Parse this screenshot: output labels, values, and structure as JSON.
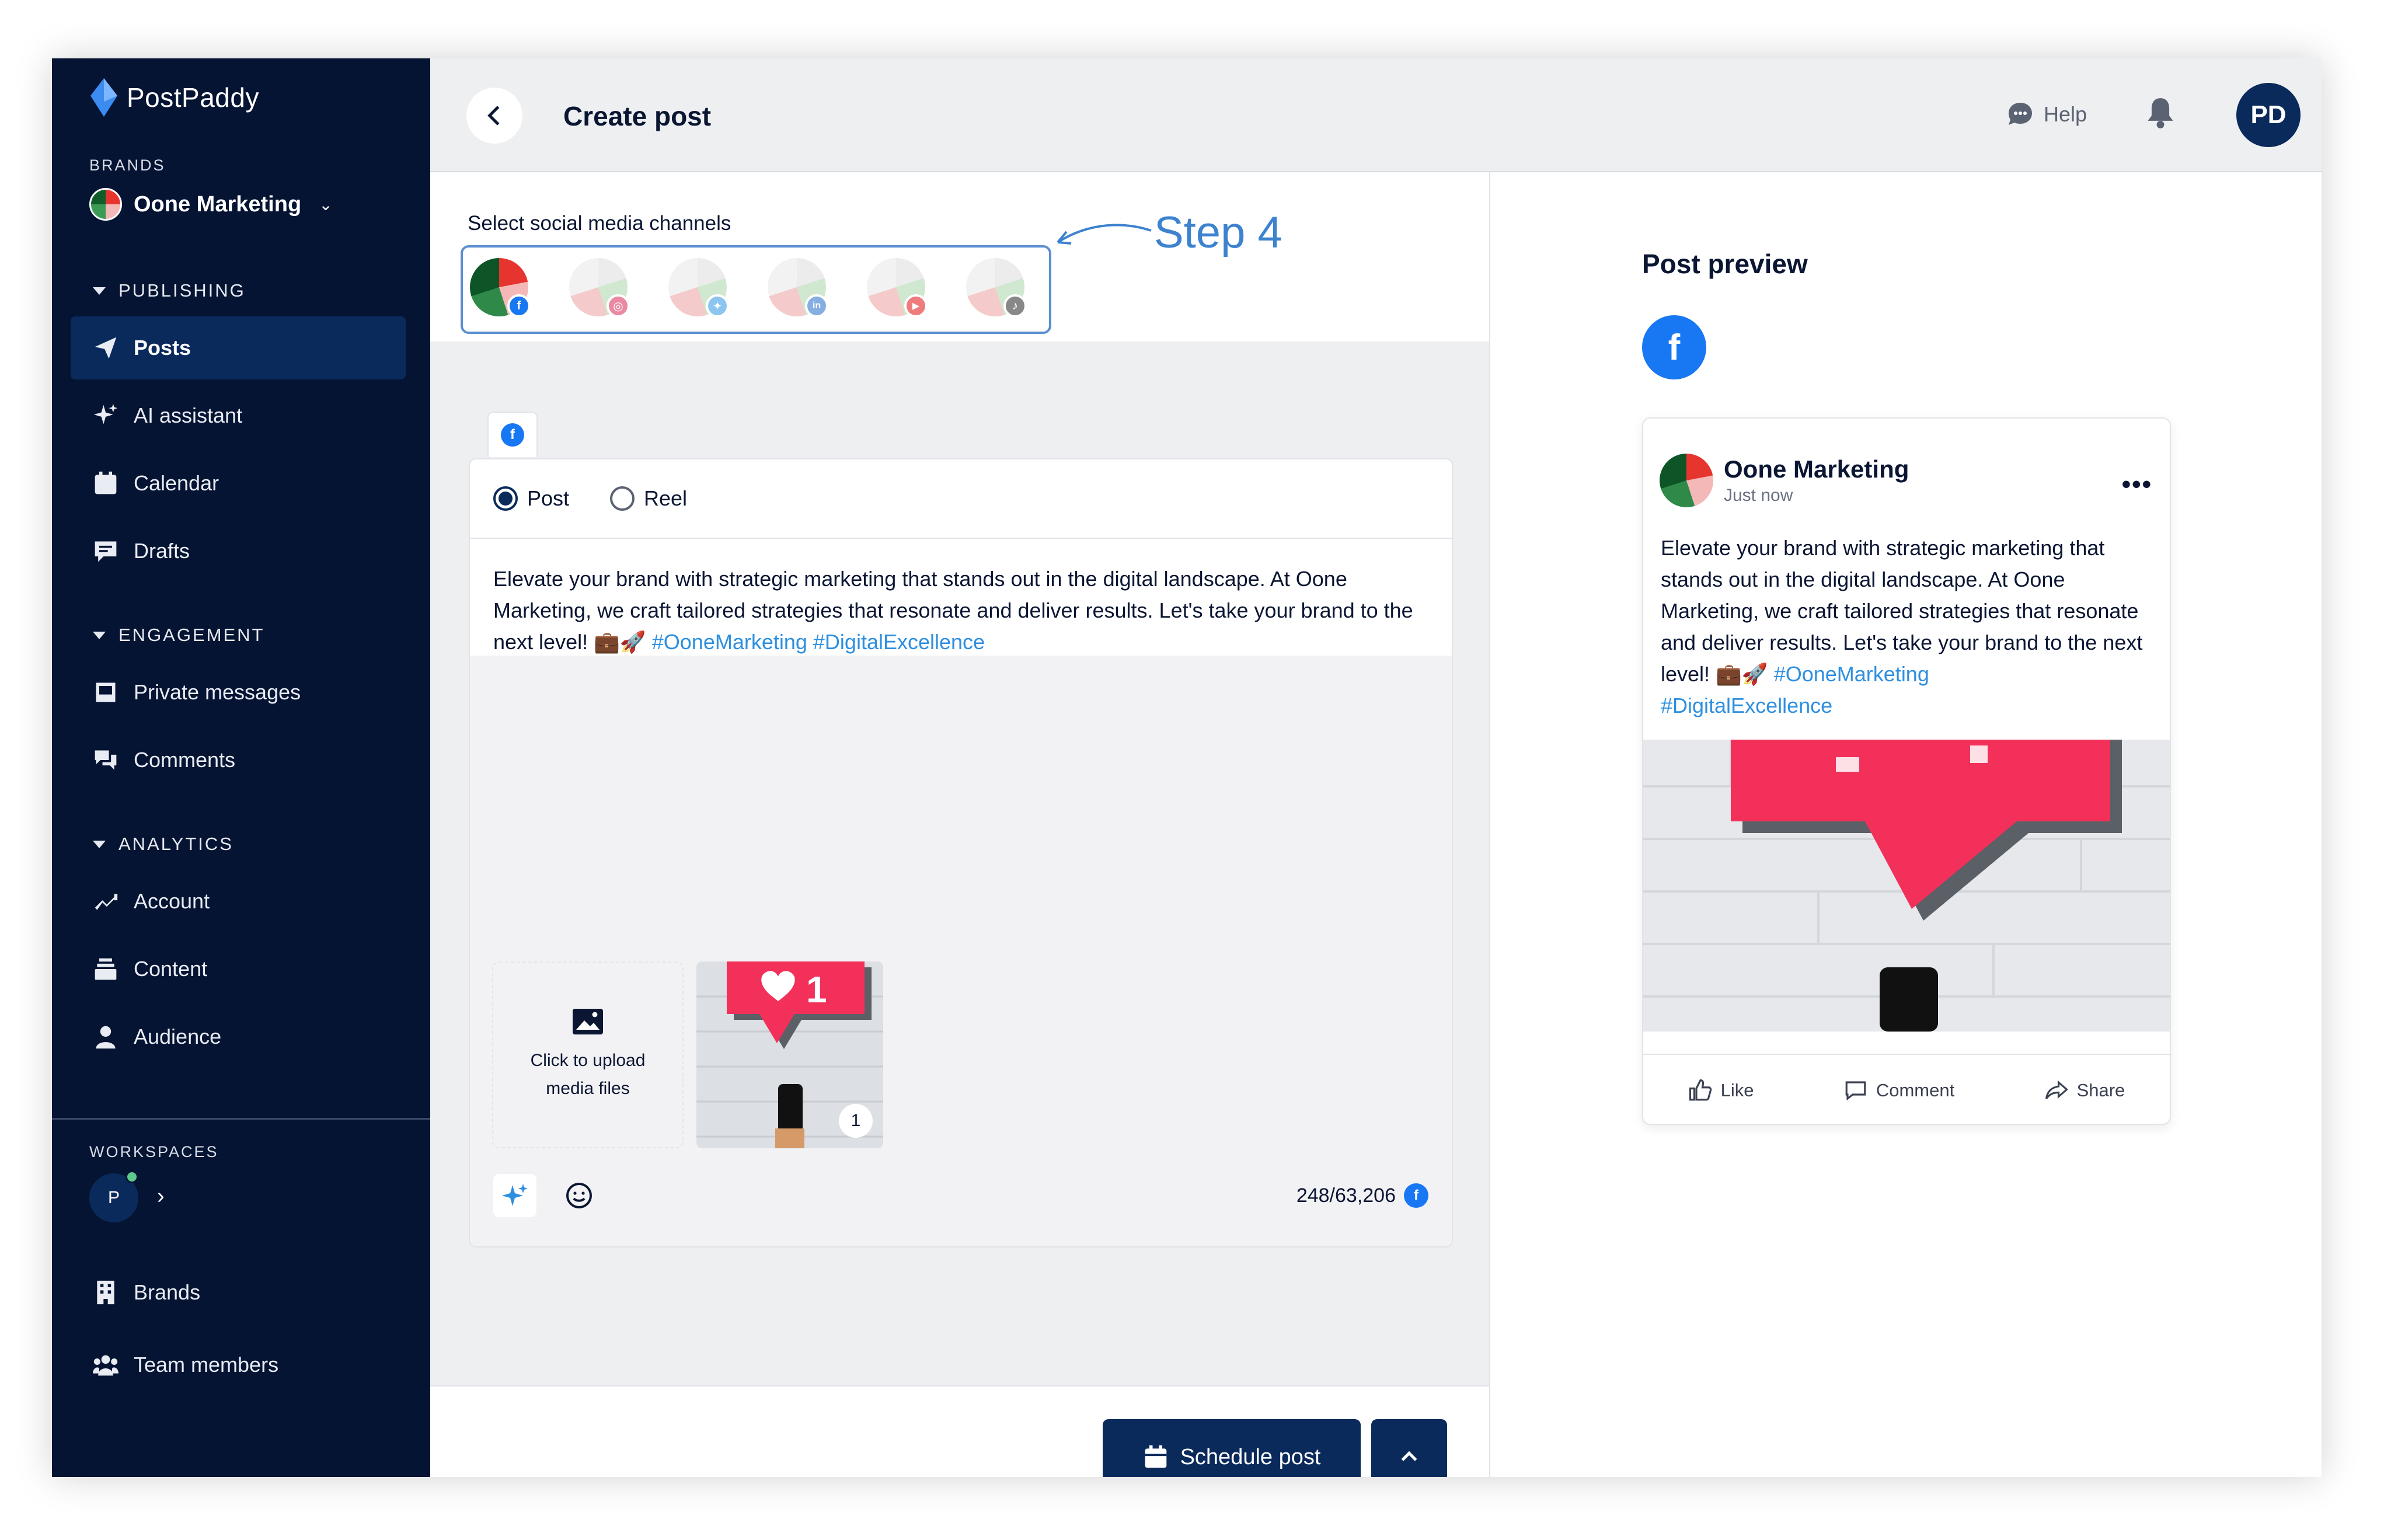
{
  "app": {
    "name": "PostPaddy"
  },
  "sidebar": {
    "brands_label": "BRANDS",
    "brand_name": "Oone Marketing",
    "publishing": {
      "label": "PUBLISHING",
      "items": [
        {
          "label": "Posts",
          "icon": "send-icon",
          "active": true
        },
        {
          "label": "AI assistant",
          "icon": "sparkle-icon"
        },
        {
          "label": "Calendar",
          "icon": "calendar-icon"
        },
        {
          "label": "Drafts",
          "icon": "drafts-icon"
        }
      ]
    },
    "engagement": {
      "label": "ENGAGEMENT",
      "items": [
        {
          "label": "Private messages",
          "icon": "inbox-icon"
        },
        {
          "label": "Comments",
          "icon": "comments-icon"
        }
      ]
    },
    "analytics": {
      "label": "ANALYTICS",
      "items": [
        {
          "label": "Account",
          "icon": "trend-icon"
        },
        {
          "label": "Content",
          "icon": "stack-icon"
        },
        {
          "label": "Audience",
          "icon": "person-icon"
        }
      ]
    },
    "workspaces_label": "WORKSPACES",
    "workspace_initial": "P",
    "bottom_items": [
      {
        "label": "Brands",
        "icon": "building-icon"
      },
      {
        "label": "Team members",
        "icon": "team-icon"
      }
    ]
  },
  "header": {
    "title": "Create post",
    "help_label": "Help",
    "user_initials": "PD"
  },
  "channels": {
    "label": "Select social media channels",
    "annotation": "Step 4",
    "items": [
      {
        "network": "facebook",
        "badge": "f",
        "color": "#1877f2",
        "selected": true
      },
      {
        "network": "instagram",
        "badge": "◎",
        "color": "#e4405f"
      },
      {
        "network": "twitter",
        "badge": "✦",
        "color": "#1da1f2"
      },
      {
        "network": "linkedin",
        "badge": "in",
        "color": "#0a66c2"
      },
      {
        "network": "youtube",
        "badge": "▶",
        "color": "#ff0000"
      },
      {
        "network": "tiktok",
        "badge": "♪",
        "color": "#111111"
      }
    ]
  },
  "composer": {
    "tab_badge": "f",
    "post_type": {
      "post_label": "Post",
      "reel_label": "Reel",
      "selected": "Post"
    },
    "text_plain": "Elevate your brand with strategic marketing that stands out in the digital landscape. At Oone Marketing, we craft tailored strategies that resonate and deliver results. Let's take your brand to the next level! 💼🚀 ",
    "hashtags": "#OoneMarketing #DigitalExcellence",
    "upload_label": "Click to upload media files",
    "media_count": "1",
    "char_count": "248/63,206"
  },
  "actions": {
    "schedule_label": "Schedule post"
  },
  "preview": {
    "title": "Post preview",
    "network_badge": "f",
    "card": {
      "name": "Oone Marketing",
      "time": "Just now",
      "text_plain": "Elevate your brand with strategic marketing that stands out in the digital landscape. At Oone Marketing, we craft tailored strategies that resonate and deliver results. Let's take your brand to the next level! 💼🚀 ",
      "hashtag1": "#OoneMarketing",
      "hashtag2": "#DigitalExcellence",
      "like": "Like",
      "comment": "Comment",
      "share": "Share"
    }
  },
  "colors": {
    "sidebar_bg": "#061433",
    "primary": "#0b2a5c",
    "facebook": "#1877f2",
    "hashtag": "#2d8fe0",
    "annotation": "#3c82cf"
  }
}
